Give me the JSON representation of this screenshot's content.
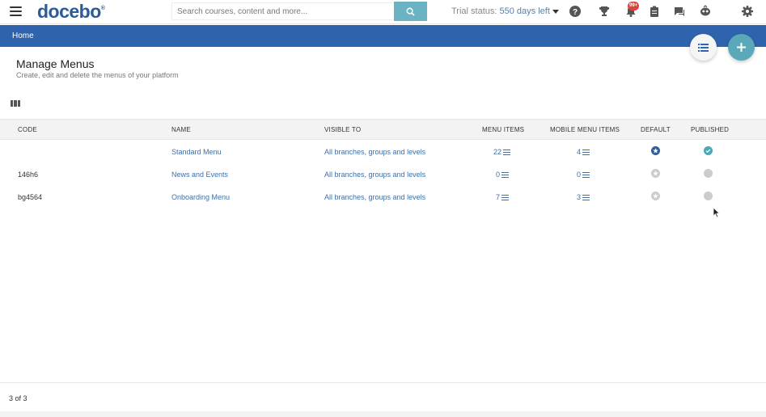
{
  "topbar": {
    "logo": "docebo",
    "logo_mark": "®",
    "search_placeholder": "Search courses, content and more...",
    "trial_label": "Trial status:",
    "trial_days": "550 days left",
    "notification_count": "99+"
  },
  "breadcrumb": {
    "home": "Home"
  },
  "page": {
    "title": "Manage Menus",
    "subtitle": "Create, edit and delete the menus of your platform"
  },
  "table": {
    "headers": {
      "code": "CODE",
      "name": "NAME",
      "visible_to": "VISIBLE TO",
      "menu_items": "MENU ITEMS",
      "mobile_menu_items": "MOBILE MENU ITEMS",
      "default": "DEFAULT",
      "published": "PUBLISHED"
    },
    "rows": [
      {
        "code": "",
        "name": "Standard Menu",
        "visible_to": "All branches, groups and levels",
        "menu_items": "22",
        "mobile_menu_items": "4",
        "default": true,
        "published": true
      },
      {
        "code": "146h6",
        "name": "News and Events",
        "visible_to": "All branches, groups and levels",
        "menu_items": "0",
        "mobile_menu_items": "0",
        "default": false,
        "published": false
      },
      {
        "code": "bg4564",
        "name": "Onboarding Menu",
        "visible_to": "All branches, groups and levels",
        "menu_items": "7",
        "mobile_menu_items": "3",
        "default": false,
        "published": false
      }
    ]
  },
  "pager": {
    "text": "3 of 3"
  },
  "colors": {
    "brand_blue": "#2f63ad",
    "accent_teal": "#5aa8b8",
    "link": "#3d6fa8",
    "default_star": "#2f5f9e",
    "published_check": "#4aa8b8",
    "inactive": "#cccccc"
  },
  "icons": {
    "menu": "hamburger-icon",
    "search": "search-icon",
    "help": "help-icon",
    "trophy": "trophy-icon",
    "bell": "bell-icon",
    "clipboard": "clipboard-icon",
    "chat": "chat-icon",
    "face": "face-icon",
    "settings": "gear-icon",
    "list": "list-icon",
    "add": "plus-icon",
    "columns": "columns-icon",
    "star": "star-icon",
    "check": "check-icon"
  }
}
